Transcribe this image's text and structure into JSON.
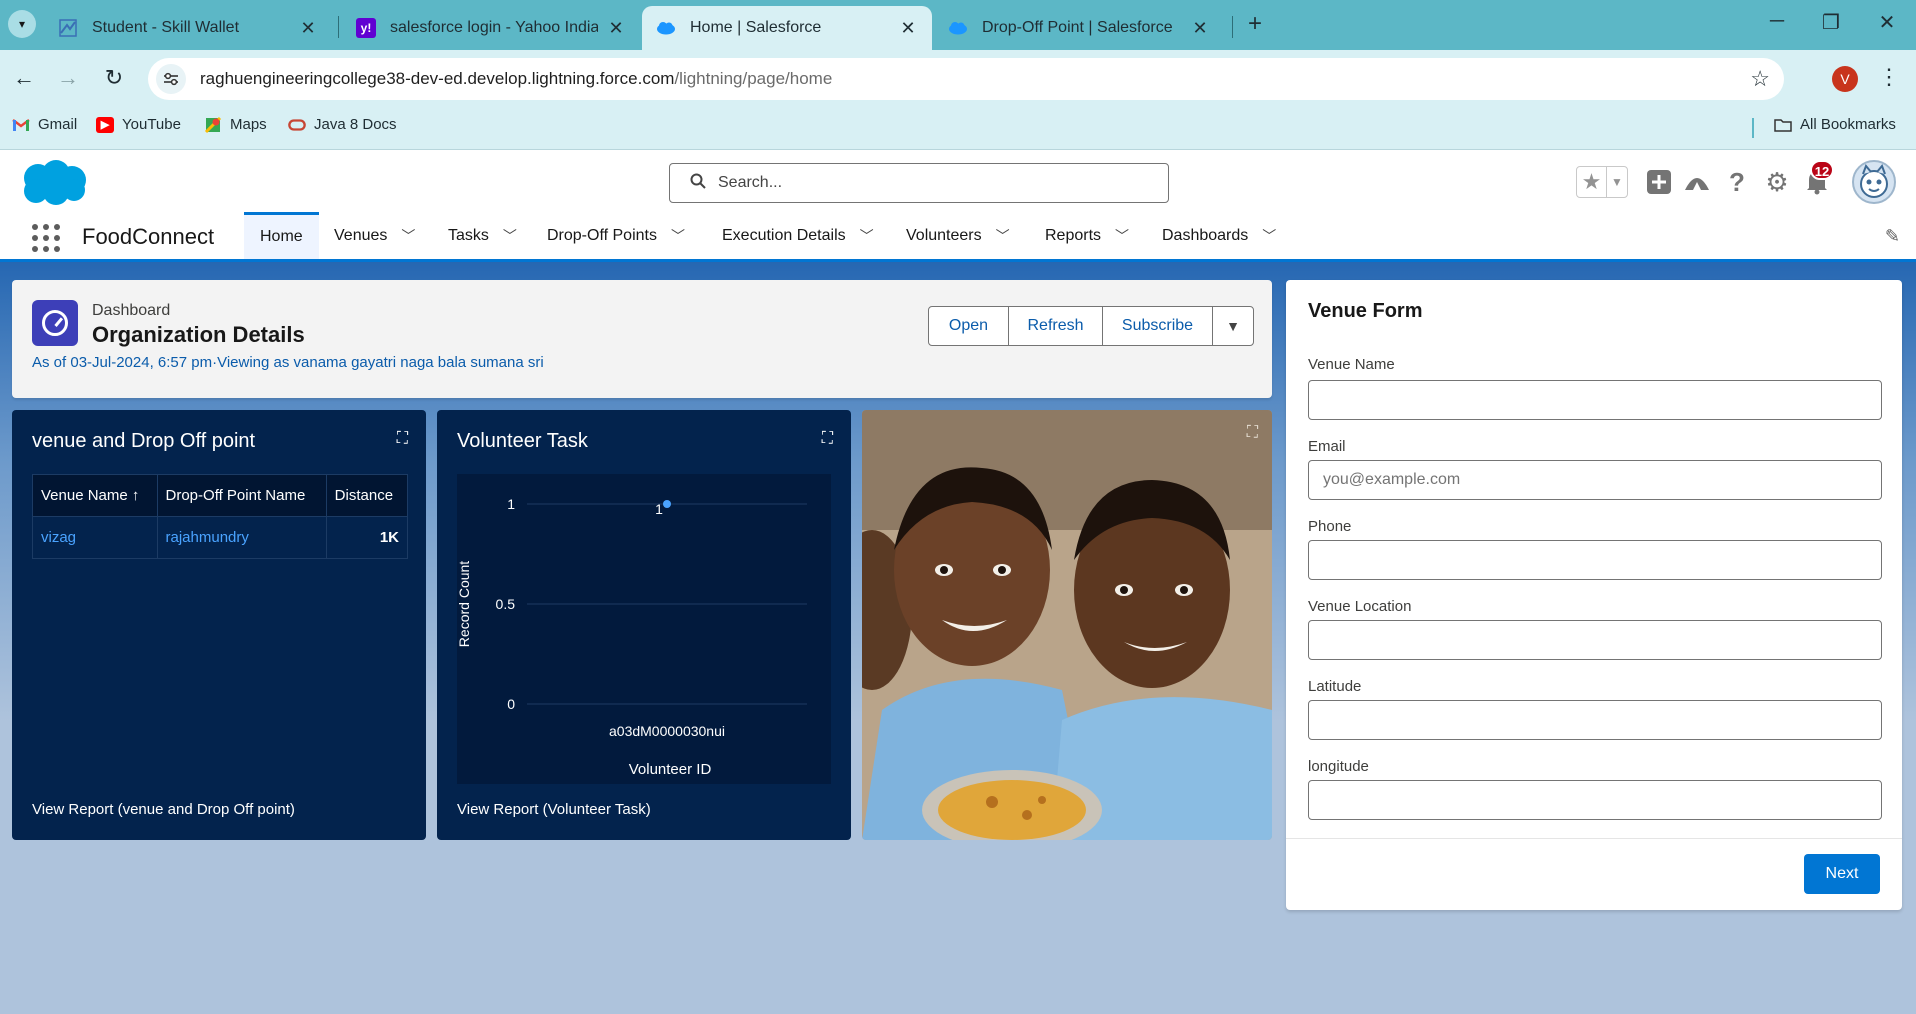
{
  "browser": {
    "tabs": [
      {
        "title": "Student - Skill Wallet",
        "icon": "skill-wallet-icon"
      },
      {
        "title": "salesforce login - Yahoo India S",
        "icon": "yahoo-icon"
      },
      {
        "title": "Home | Salesforce",
        "icon": "salesforce-cloud-icon"
      },
      {
        "title": "Drop-Off Point | Salesforce",
        "icon": "salesforce-cloud-icon"
      }
    ],
    "active_tab": 2,
    "url_host": "raghuengineeringcollege38-dev-ed.develop.lightning.force.com",
    "url_path": "/lightning/page/home",
    "profile_initial": "V",
    "bookmarks": [
      {
        "label": "Gmail",
        "icon": "gmail-icon"
      },
      {
        "label": "YouTube",
        "icon": "youtube-icon"
      },
      {
        "label": "Maps",
        "icon": "maps-icon"
      },
      {
        "label": "Java 8 Docs",
        "icon": "oracle-icon"
      }
    ],
    "all_bookmarks": "All Bookmarks"
  },
  "sf": {
    "search_placeholder": "Search...",
    "notification_count": "12",
    "app_name": "FoodConnect",
    "nav": [
      {
        "label": "Home",
        "active": true
      },
      {
        "label": "Venues"
      },
      {
        "label": "Tasks"
      },
      {
        "label": "Drop-Off Points"
      },
      {
        "label": "Execution Details"
      },
      {
        "label": "Volunteers"
      },
      {
        "label": "Reports"
      },
      {
        "label": "Dashboards"
      }
    ]
  },
  "dashboard": {
    "label": "Dashboard",
    "title": "Organization Details",
    "meta": "As of 03-Jul-2024, 6:57 pm·Viewing as vanama gayatri naga bala sumana sri",
    "buttons": {
      "open": "Open",
      "refresh": "Refresh",
      "subscribe": "Subscribe"
    }
  },
  "venue_tile": {
    "title": "venue and Drop Off point",
    "columns": [
      "Venue Name ↑",
      "Drop-Off Point Name",
      "Distance"
    ],
    "rows": [
      [
        "vizag",
        "rajahmundry",
        "1K"
      ]
    ],
    "footer": "View Report (venue and Drop Off point)"
  },
  "volunteer_tile": {
    "title": "Volunteer Task",
    "footer": "View Report (Volunteer Task)"
  },
  "chart_data": {
    "type": "scatter",
    "categories": [
      "a03dM0000030nui"
    ],
    "values": [
      1
    ],
    "data_labels": [
      "1"
    ],
    "xlabel": "Volunteer ID",
    "ylabel": "Record Count",
    "ylim": [
      0,
      1
    ],
    "yticks": [
      "1",
      "0.5",
      "0"
    ],
    "grid": true,
    "colors": {
      "point": "#4aa3ff"
    }
  },
  "venue_form": {
    "title": "Venue Form",
    "fields": [
      {
        "label": "Venue Name",
        "placeholder": ""
      },
      {
        "label": "Email",
        "placeholder": "you@example.com"
      },
      {
        "label": "Phone",
        "placeholder": ""
      },
      {
        "label": "Venue Location",
        "placeholder": ""
      },
      {
        "label": "Latitude",
        "placeholder": ""
      },
      {
        "label": "longitude",
        "placeholder": ""
      }
    ],
    "next_label": "Next"
  },
  "colors": {
    "brand": "#0176d3",
    "tile_bg": "#03234d",
    "link": "#0b5cab"
  }
}
